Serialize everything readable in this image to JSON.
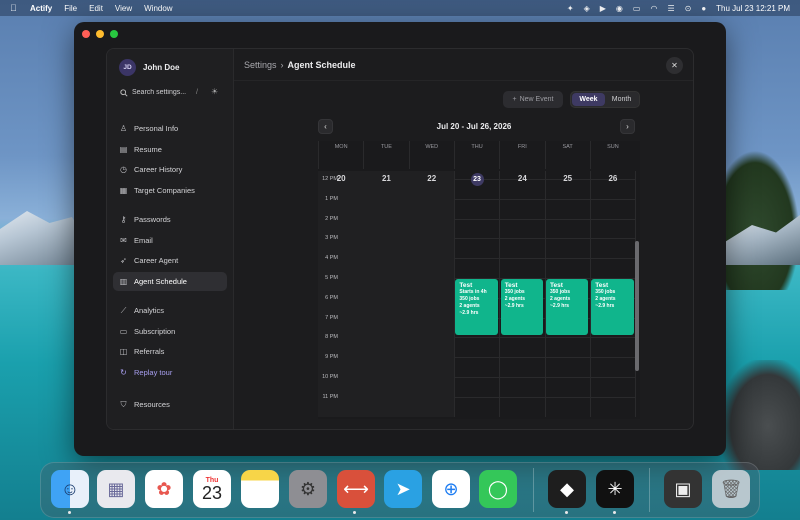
{
  "menubar": {
    "app": "Actify",
    "menus": [
      "File",
      "Edit",
      "View",
      "Window"
    ],
    "clock": "Thu Jul 23  12:21 PM"
  },
  "sidebar": {
    "user": {
      "initials": "JD",
      "name": "John Doe"
    },
    "search_placeholder": "Search settings...",
    "search_shortcut": "/",
    "groups": [
      [
        {
          "label": "Personal Info",
          "icon": "person-icon"
        },
        {
          "label": "Resume",
          "icon": "document-icon"
        },
        {
          "label": "Career History",
          "icon": "history-icon"
        },
        {
          "label": "Target Companies",
          "icon": "building-icon"
        }
      ],
      [
        {
          "label": "Passwords",
          "icon": "key-icon"
        },
        {
          "label": "Email",
          "icon": "mail-icon"
        },
        {
          "label": "Career Agent",
          "icon": "rocket-icon"
        },
        {
          "label": "Agent Schedule",
          "icon": "calendar-icon",
          "active": true
        }
      ],
      [
        {
          "label": "Analytics",
          "icon": "chart-icon"
        },
        {
          "label": "Subscription",
          "icon": "card-icon"
        },
        {
          "label": "Referrals",
          "icon": "gift-icon"
        },
        {
          "label": "Replay tour",
          "icon": "replay-icon",
          "accent": true
        }
      ],
      [
        {
          "label": "Resources",
          "icon": "shield-icon"
        }
      ]
    ]
  },
  "main": {
    "breadcrumb": {
      "parent": "Settings",
      "sep": "›",
      "current": "Agent Schedule"
    },
    "new_event": "New Event",
    "view_toggle": {
      "week": "Week",
      "month": "Month",
      "selected": "Week"
    },
    "range_label": "Jul 20 - Jul 26, 2026",
    "days": [
      {
        "name": "MON",
        "date": "20"
      },
      {
        "name": "TUE",
        "date": "21"
      },
      {
        "name": "WED",
        "date": "22"
      },
      {
        "name": "THU",
        "date": "23",
        "today": true
      },
      {
        "name": "FRI",
        "date": "24"
      },
      {
        "name": "SAT",
        "date": "25"
      },
      {
        "name": "SUN",
        "date": "26"
      }
    ],
    "hours": [
      "12 PM",
      "1 PM",
      "2 PM",
      "3 PM",
      "4 PM",
      "5 PM",
      "6 PM",
      "7 PM",
      "8 PM",
      "9 PM",
      "10 PM",
      "11 PM"
    ],
    "events": [
      {
        "day_index": 3,
        "title": "Test",
        "lines": [
          "Starts in 4h",
          "350 jobs",
          "2 agents",
          "~2.9 hrs"
        ]
      },
      {
        "day_index": 4,
        "title": "Test",
        "lines": [
          "350 jobs",
          "2 agents",
          "~2.9 hrs"
        ]
      },
      {
        "day_index": 5,
        "title": "Test",
        "lines": [
          "350 jobs",
          "2 agents",
          "~2.9 hrs"
        ]
      },
      {
        "day_index": 6,
        "title": "Test",
        "lines": [
          "350 jobs",
          "2 agents",
          "~2.9 hrs"
        ]
      }
    ],
    "colors": {
      "event": "#10b58c",
      "accent": "#3e3a63"
    }
  },
  "dock": {
    "calendar_month": "Thu",
    "calendar_day": "23",
    "apps": [
      "finder-icon",
      "launchpad-icon",
      "photos-icon",
      "calendar-icon",
      "notes-icon",
      "settings-icon",
      "remote-desktop-icon",
      "telegram-icon",
      "safari-icon",
      "messages-icon",
      "cursor-icon",
      "perplexity-icon",
      "downloads-icon",
      "trash-icon"
    ]
  }
}
